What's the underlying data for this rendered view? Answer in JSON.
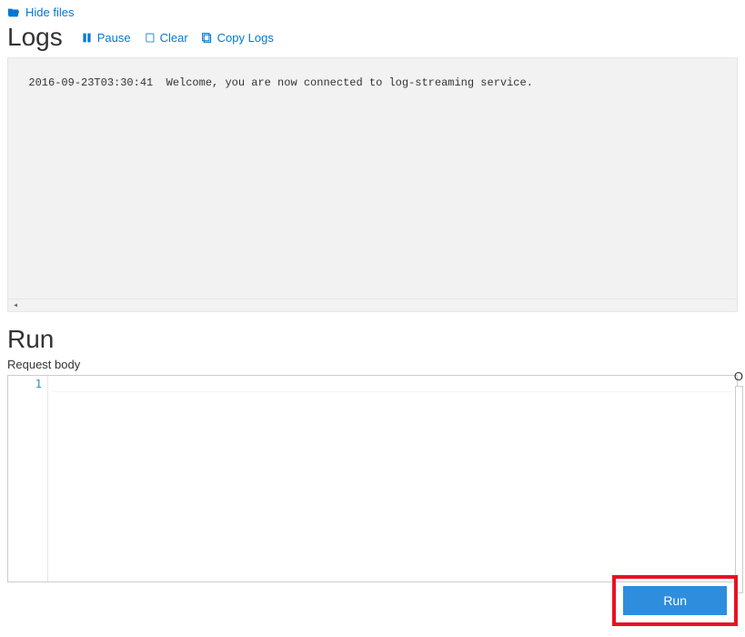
{
  "top": {
    "hide_files": "Hide files"
  },
  "logs": {
    "title": "Logs",
    "pause": "Pause",
    "clear": "Clear",
    "copy": "Copy Logs",
    "content": "2016-09-23T03:30:41  Welcome, you are now connected to log-streaming service."
  },
  "run": {
    "title": "Run",
    "request_body_label": "Request body",
    "output_label_partial": "O",
    "line_number": "1",
    "run_button": "Run"
  }
}
